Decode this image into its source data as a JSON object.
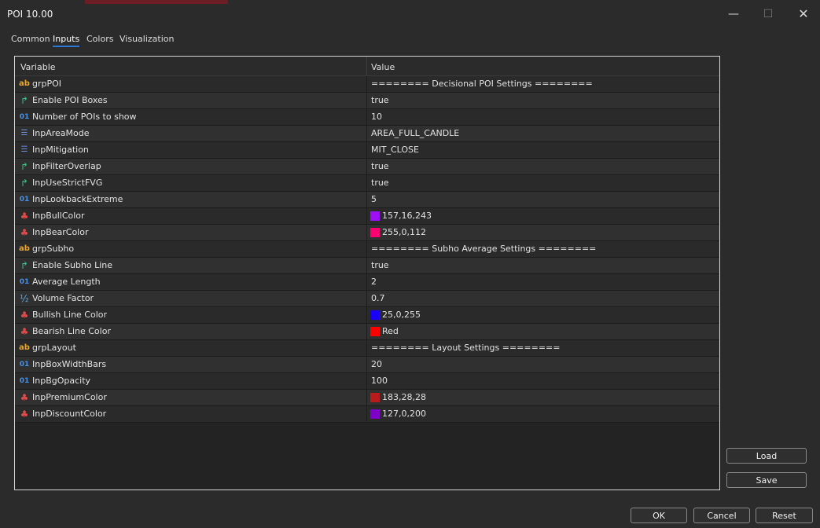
{
  "window": {
    "title": "POI 10.00"
  },
  "tabs": [
    {
      "label": "Common",
      "active": false
    },
    {
      "label": "Inputs",
      "active": true
    },
    {
      "label": "Colors",
      "active": false
    },
    {
      "label": "Visualization",
      "active": false
    }
  ],
  "table": {
    "headers": {
      "variable": "Variable",
      "value": "Value"
    },
    "rows": [
      {
        "icon": "string-icon",
        "variable": "grpPOI",
        "value": "======== Decisional POI Settings ========"
      },
      {
        "icon": "bool-icon",
        "variable": "Enable POI Boxes",
        "value": "true"
      },
      {
        "icon": "int-icon",
        "variable": "Number of POIs to show",
        "value": "10"
      },
      {
        "icon": "enum-icon",
        "variable": "InpAreaMode",
        "value": "AREA_FULL_CANDLE"
      },
      {
        "icon": "enum-icon",
        "variable": "InpMitigation",
        "value": "MIT_CLOSE"
      },
      {
        "icon": "bool-icon",
        "variable": "InpFilterOverlap",
        "value": "true"
      },
      {
        "icon": "bool-icon",
        "variable": "InpUseStrictFVG",
        "value": "true"
      },
      {
        "icon": "int-icon",
        "variable": "InpLookbackExtreme",
        "value": "5"
      },
      {
        "icon": "color-icon",
        "variable": "InpBullColor",
        "value": "157,16,243",
        "swatch": "#9d10f3"
      },
      {
        "icon": "color-icon",
        "variable": "InpBearColor",
        "value": "255,0,112",
        "swatch": "#ff0070"
      },
      {
        "icon": "string-icon",
        "variable": "grpSubho",
        "value": "======== Subho Average Settings ========"
      },
      {
        "icon": "bool-icon",
        "variable": "Enable Subho Line",
        "value": "true"
      },
      {
        "icon": "int-icon",
        "variable": "Average Length",
        "value": "2"
      },
      {
        "icon": "float-icon",
        "variable": "Volume Factor",
        "value": "0.7"
      },
      {
        "icon": "color-icon",
        "variable": "Bullish Line Color",
        "value": "25,0,255",
        "swatch": "#1900ff"
      },
      {
        "icon": "color-icon",
        "variable": "Bearish Line Color",
        "value": "Red",
        "swatch": "#ff0000"
      },
      {
        "icon": "string-icon",
        "variable": "grpLayout",
        "value": "======== Layout Settings ========"
      },
      {
        "icon": "int-icon",
        "variable": "InpBoxWidthBars",
        "value": "20"
      },
      {
        "icon": "int-icon",
        "variable": "InpBgOpacity",
        "value": "100"
      },
      {
        "icon": "color-icon",
        "variable": "InpPremiumColor",
        "value": "183,28,28",
        "swatch": "#b71c1c"
      },
      {
        "icon": "color-icon",
        "variable": "InpDiscountColor",
        "value": "127,0,200",
        "swatch": "#7f00c8"
      }
    ]
  },
  "buttons": {
    "load": "Load",
    "save": "Save",
    "ok": "OK",
    "cancel": "Cancel",
    "reset": "Reset"
  },
  "icon_glyphs": {
    "string-icon": "ab",
    "bool-icon": "↱",
    "int-icon": "01",
    "enum-icon": "☰",
    "color-icon": "♣",
    "float-icon": "½"
  }
}
